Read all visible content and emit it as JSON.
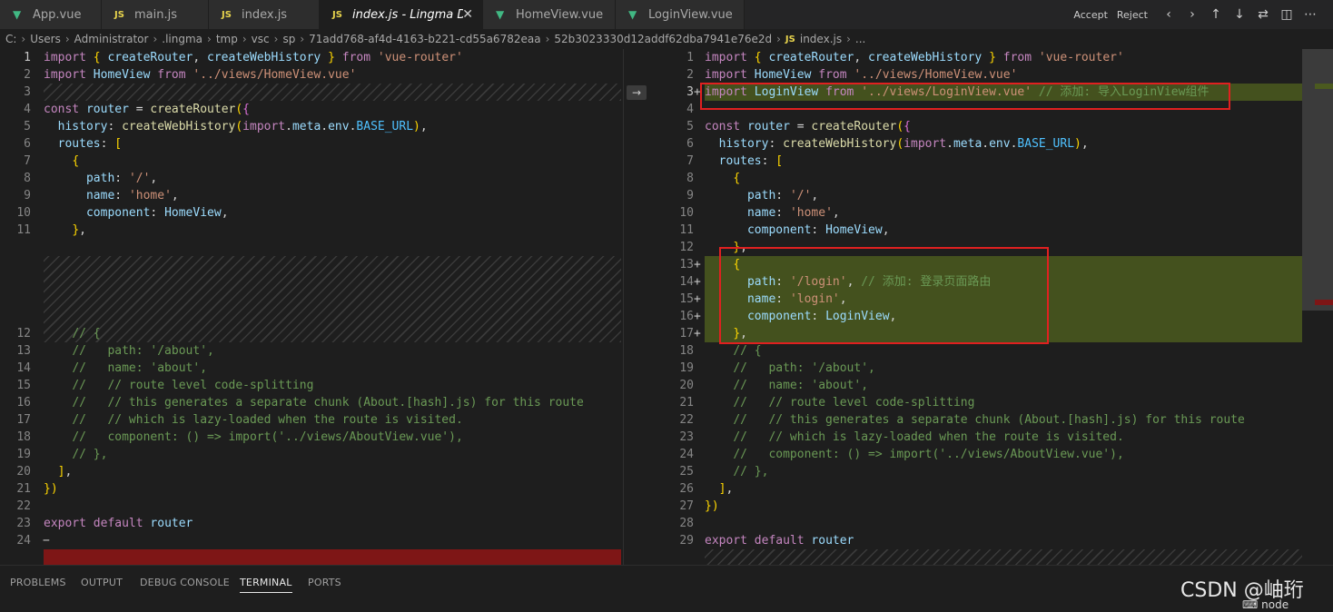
{
  "tabs": [
    {
      "label": "App.vue",
      "icon": "vue-icon",
      "active": false
    },
    {
      "label": "main.js",
      "icon": "js-icon",
      "active": false
    },
    {
      "label": "index.js",
      "icon": "js-icon",
      "active": false
    },
    {
      "label": "index.js - Lingma Diff",
      "icon": "js-icon",
      "active": true
    },
    {
      "label": "HomeView.vue",
      "icon": "vue-icon",
      "active": false
    },
    {
      "label": "LoginView.vue",
      "icon": "vue-icon",
      "active": false
    }
  ],
  "actions": {
    "accept": "Accept",
    "reject": "Reject"
  },
  "breadcrumb": [
    "C:",
    "Users",
    "Administrator",
    ".lingma",
    "tmp",
    "vsc",
    "sp",
    "71add768-af4d-4163-b221-cd55a6782eaa",
    "52b3023330d12addf62dba7941e76e2d",
    "index.js",
    "..."
  ],
  "left_pane": {
    "lines": [
      {
        "n": "1",
        "code": "import { createRouter, createWebHistory } from 'vue-router'"
      },
      {
        "n": "2",
        "code": "import HomeView from '../views/HomeView.vue'"
      },
      {
        "n": "3",
        "code": ""
      },
      {
        "n": "4",
        "code": "const router = createRouter({"
      },
      {
        "n": "5",
        "code": "  history: createWebHistory(import.meta.env.BASE_URL),"
      },
      {
        "n": "6",
        "code": "  routes: ["
      },
      {
        "n": "7",
        "code": "    {"
      },
      {
        "n": "8",
        "code": "      path: '/',"
      },
      {
        "n": "9",
        "code": "      name: 'home',"
      },
      {
        "n": "10",
        "code": "      component: HomeView,"
      },
      {
        "n": "11",
        "code": "    },"
      },
      {
        "n": "12",
        "code": "    // {"
      },
      {
        "n": "13",
        "code": "    //   path: '/about',"
      },
      {
        "n": "14",
        "code": "    //   name: 'about',"
      },
      {
        "n": "15",
        "code": "    //   // route level code-splitting"
      },
      {
        "n": "16",
        "code": "    //   // this generates a separate chunk (About.[hash].js) for this route"
      },
      {
        "n": "17",
        "code": "    //   // which is lazy-loaded when the route is visited."
      },
      {
        "n": "18",
        "code": "    //   component: () => import('../views/AboutView.vue'),"
      },
      {
        "n": "19",
        "code": "    // },"
      },
      {
        "n": "20",
        "code": "  ],"
      },
      {
        "n": "21",
        "code": "})"
      },
      {
        "n": "22",
        "code": ""
      },
      {
        "n": "23",
        "code": "export default router"
      },
      {
        "n": "24",
        "code": ""
      }
    ]
  },
  "right_pane": {
    "lines": [
      {
        "n": "1",
        "code": "import { createRouter, createWebHistory } from 'vue-router'"
      },
      {
        "n": "2",
        "code": "import HomeView from '../views/HomeView.vue'"
      },
      {
        "n": "3",
        "code": "import LoginView from '../views/LoginView.vue' // 添加: 导入LoginView组件"
      },
      {
        "n": "4",
        "code": ""
      },
      {
        "n": "5",
        "code": "const router = createRouter({"
      },
      {
        "n": "6",
        "code": "  history: createWebHistory(import.meta.env.BASE_URL),"
      },
      {
        "n": "7",
        "code": "  routes: ["
      },
      {
        "n": "8",
        "code": "    {"
      },
      {
        "n": "9",
        "code": "      path: '/',"
      },
      {
        "n": "10",
        "code": "      name: 'home',"
      },
      {
        "n": "11",
        "code": "      component: HomeView,"
      },
      {
        "n": "12",
        "code": "    },"
      },
      {
        "n": "13",
        "code": "    {"
      },
      {
        "n": "14",
        "code": "      path: '/login', // 添加: 登录页面路由"
      },
      {
        "n": "15",
        "code": "      name: 'login',"
      },
      {
        "n": "16",
        "code": "      component: LoginView,"
      },
      {
        "n": "17",
        "code": "    },"
      },
      {
        "n": "18",
        "code": "    // {"
      },
      {
        "n": "19",
        "code": "    //   path: '/about',"
      },
      {
        "n": "20",
        "code": "    //   name: 'about',"
      },
      {
        "n": "21",
        "code": "    //   // route level code-splitting"
      },
      {
        "n": "22",
        "code": "    //   // this generates a separate chunk (About.[hash].js) for this route"
      },
      {
        "n": "23",
        "code": "    //   // which is lazy-loaded when the route is visited."
      },
      {
        "n": "24",
        "code": "    //   component: () => import('../views/AboutView.vue'),"
      },
      {
        "n": "25",
        "code": "    // },"
      },
      {
        "n": "26",
        "code": "  ],"
      },
      {
        "n": "27",
        "code": "})"
      },
      {
        "n": "28",
        "code": ""
      },
      {
        "n": "29",
        "code": "export default router"
      }
    ]
  },
  "panel_tabs": [
    "PROBLEMS",
    "OUTPUT",
    "DEBUG CONSOLE",
    "TERMINAL",
    "PORTS"
  ],
  "panel_active": "TERMINAL",
  "terminal_label": "node",
  "watermark": "CSDN @岫珩",
  "colors": {
    "added": "#4b5a1f",
    "removed": "#7e1616",
    "highlight_box": "#e02020",
    "accent_js": "#e8d44d",
    "accent_vue": "#41b883"
  }
}
